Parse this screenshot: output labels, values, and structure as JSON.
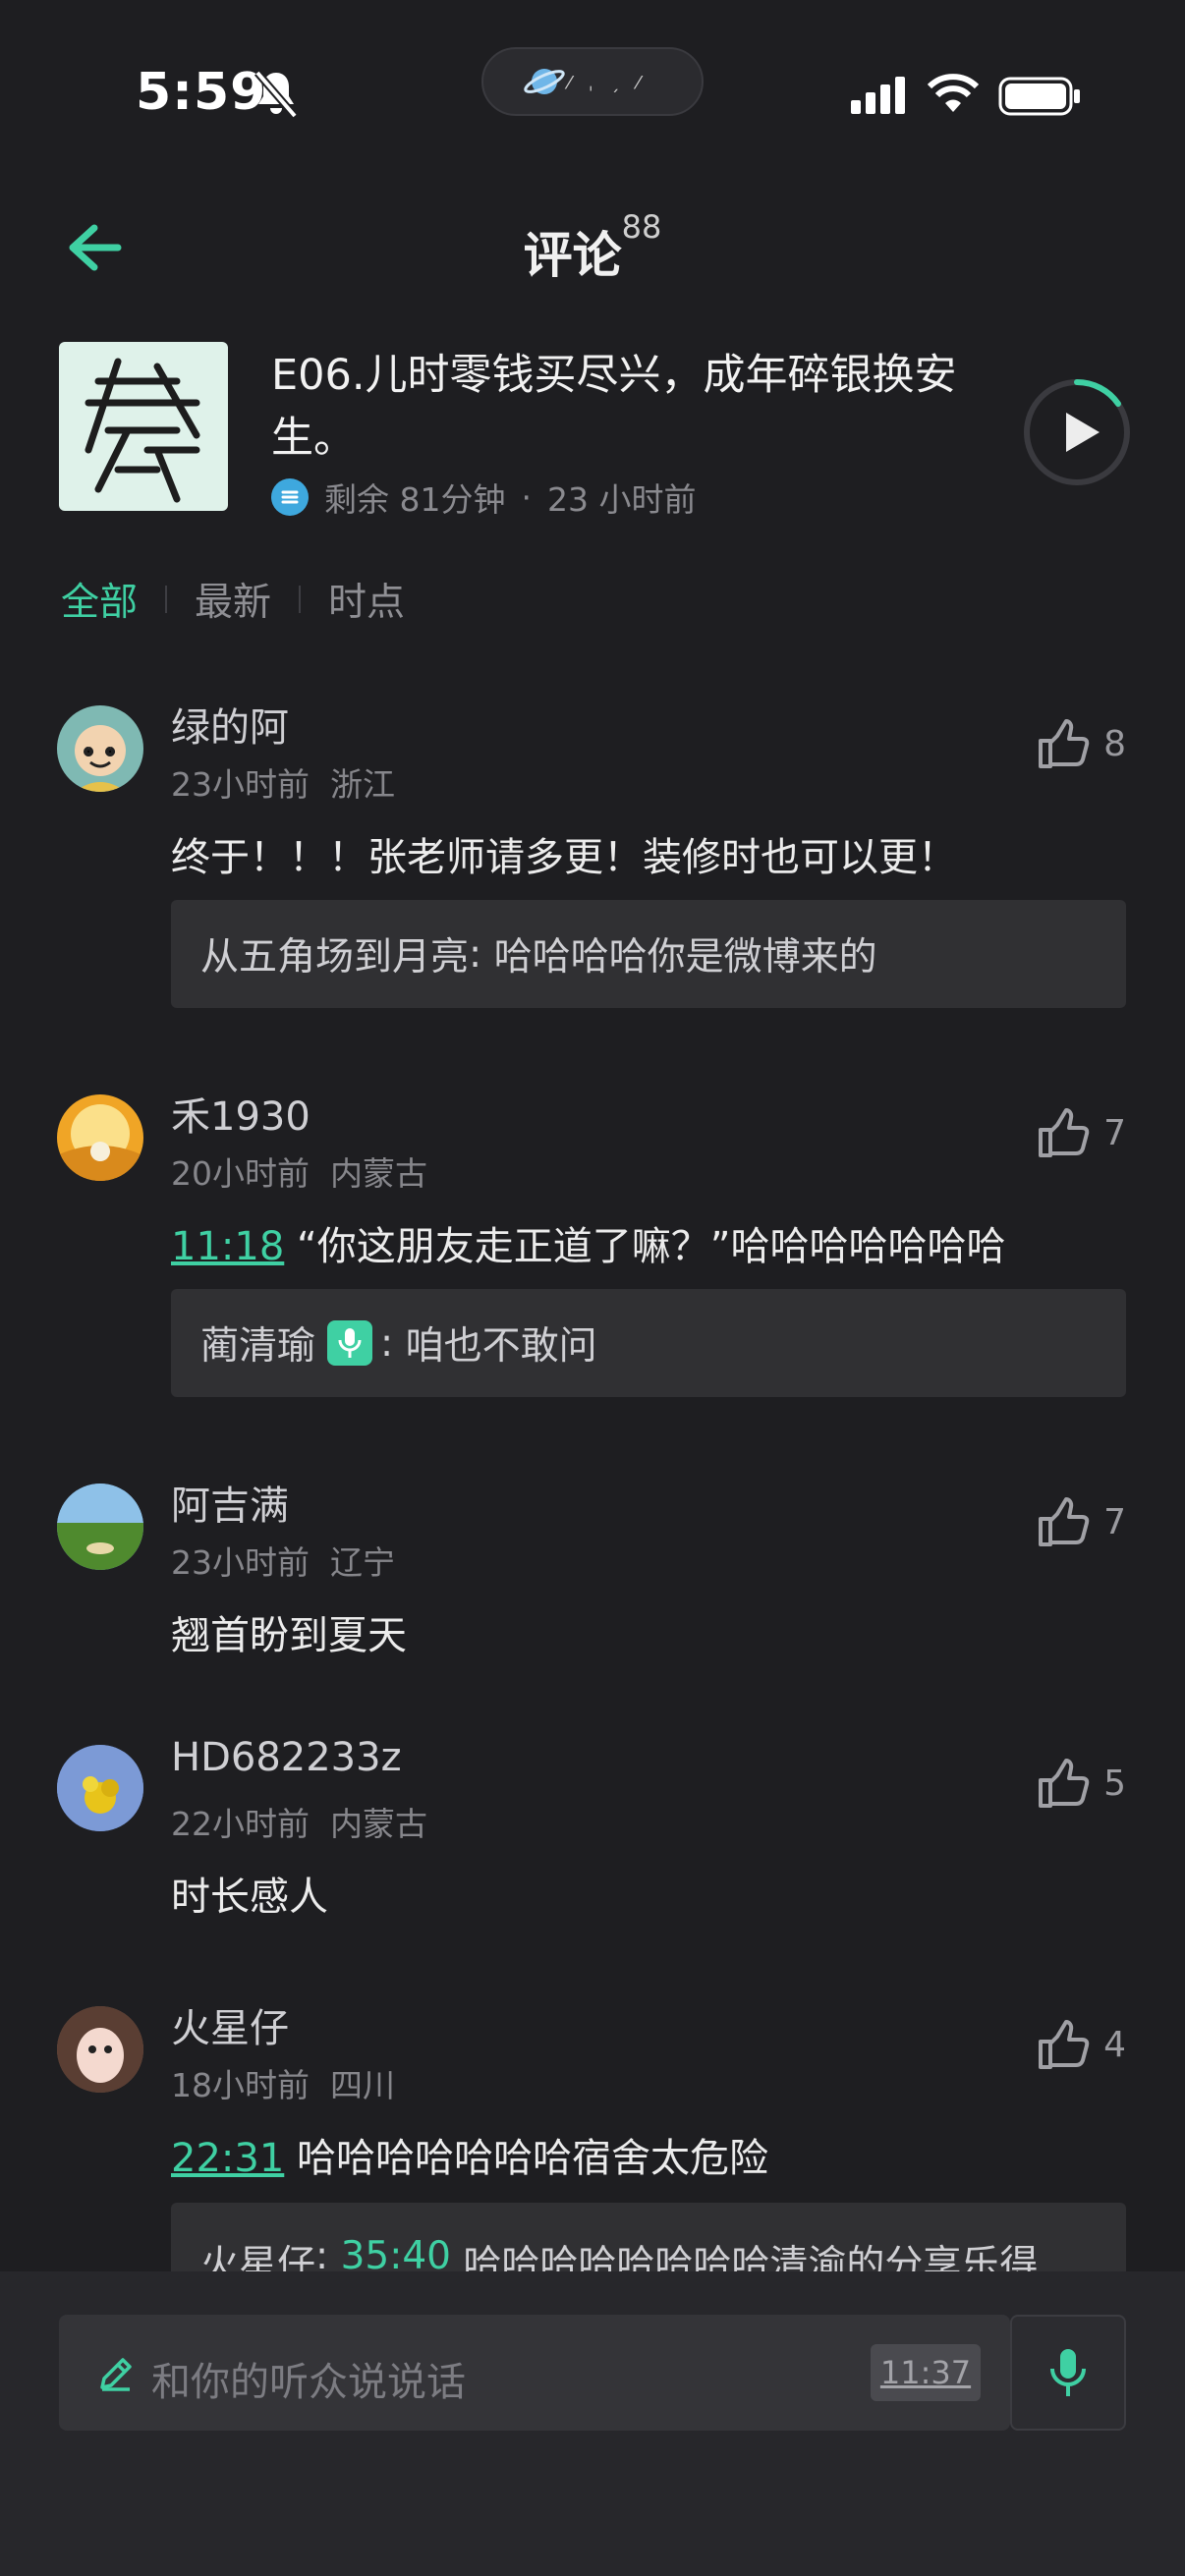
{
  "status_bar": {
    "time": "5:59"
  },
  "header": {
    "title": "评论",
    "count": "88"
  },
  "episode": {
    "title": "E06.儿时零钱买尽兴，成年碎银换安生。",
    "remaining": "剩余 81分钟",
    "dot": "·",
    "published": "23 小时前"
  },
  "tabs": [
    {
      "label": "全部",
      "active": true
    },
    {
      "label": "最新"
    },
    {
      "label": "时点"
    }
  ],
  "comments": [
    {
      "name": "绿的阿",
      "time": "23小时前",
      "region": "浙江",
      "likes": "8",
      "text": "终于！！！张老师请多更！装修时也可以更！",
      "reply": {
        "name": "从五角场到月亮",
        "text": "哈哈哈哈你是微博来的"
      }
    },
    {
      "name": "禾1930",
      "time": "20小时前",
      "region": "内蒙古",
      "likes": "7",
      "timestamp": "11:18",
      "text": "“你这朋友走正道了嘛？”哈哈哈哈哈哈哈",
      "reply": {
        "name": "蔺清瑜",
        "text": "咱也不敢问"
      }
    },
    {
      "name": "阿吉满",
      "time": "23小时前",
      "region": "辽宁",
      "likes": "7",
      "text": "翘首盼到夏天"
    },
    {
      "name": "HD682233z",
      "time": "22小时前",
      "region": "内蒙古",
      "likes": "5",
      "text": "时长感人"
    },
    {
      "name": "火星仔",
      "time": "18小时前",
      "region": "四川",
      "likes": "4",
      "timestamp": "22:31",
      "text": "哈哈哈哈哈哈哈宿舍太危险",
      "reply": {
        "name": "火星仔",
        "timestamp": "35:40",
        "text": "哈哈哈哈哈哈哈哈清渝的分享乐得"
      }
    }
  ],
  "input": {
    "placeholder": "和你的听众说说话",
    "time_chip": "11:37"
  },
  "colors": {
    "accent": "#3fd0a3",
    "background": "#1e1e21",
    "panel": "#27272b"
  },
  "icons": [
    "back-arrow-icon",
    "thumbs-up-icon",
    "mic-icon",
    "pen-icon",
    "play-icon",
    "list-icon"
  ]
}
